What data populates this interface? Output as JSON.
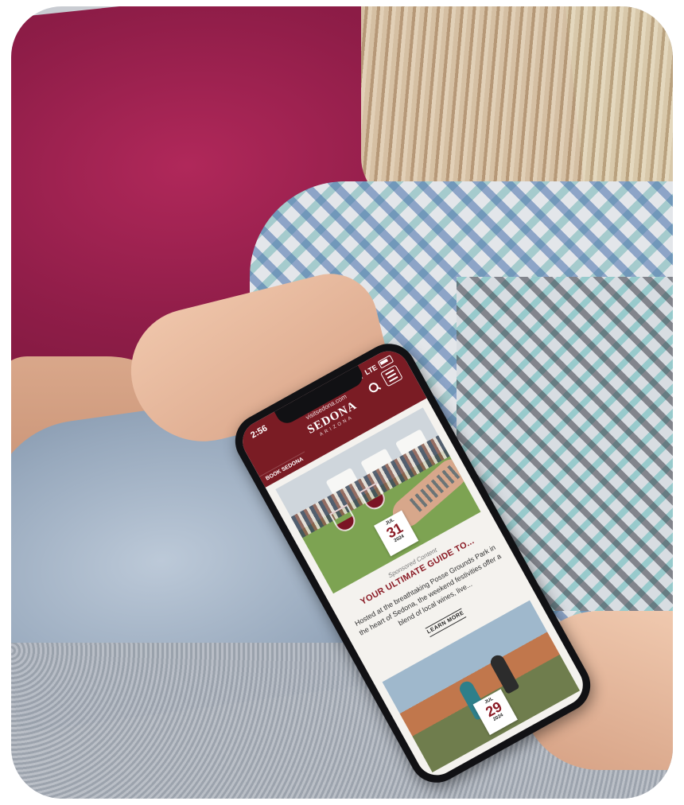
{
  "status_bar": {
    "time": "2:56",
    "network": "LTE"
  },
  "browser": {
    "url": "visitsedona.com"
  },
  "brand": {
    "name": "SEDONA",
    "subtitle": "ARIZONA"
  },
  "nav": {
    "book_tab": "BOOK SEDONA",
    "search_icon": "search-icon",
    "menu_icon": "hamburger-menu-icon"
  },
  "card1": {
    "date": {
      "month": "JUL",
      "day": "31",
      "year": "2024"
    },
    "sponsored": "Sponsored Content",
    "title": "YOUR ULTIMATE GUIDE TO...",
    "body": "Hosted at the breathtaking Posse Grounds Park in the heart of Sedona, the weekend festivities offer a blend of local wines, live...",
    "cta": "LEARN MORE"
  },
  "card2": {
    "date": {
      "month": "JUL",
      "day": "29",
      "year": "2024"
    }
  },
  "colors": {
    "brand_red": "#7a1c24",
    "accent_red": "#8b1c26"
  }
}
